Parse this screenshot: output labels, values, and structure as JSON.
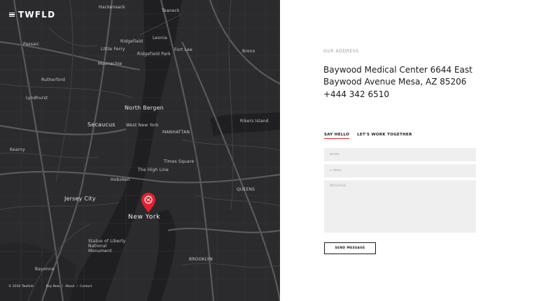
{
  "header": {
    "logo": "TWFLD",
    "menu_icon": "hamburger-menu-icon"
  },
  "map": {
    "labels": {
      "hackensack": "Hackensack",
      "teaneck": "Teaneck",
      "leonia": "Leonia",
      "fort_lee": "Fort Lee",
      "ridgefield": "Ridgefield",
      "ridgefield_park": "Ridgefield Park",
      "little_ferry": "Little Ferry",
      "passaic": "Passaic",
      "moonachie": "Moonachie",
      "bronx": "Bronx",
      "rutherford": "Rutherford",
      "lyndhurst": "Lyndhurst",
      "north_bergen": "North Bergen",
      "secaucus": "Secaucus",
      "west_new_york": "West New York",
      "manhattan": "MANHATTAN",
      "rikers_island": "Rikers Island",
      "kearny": "Kearny",
      "times_square": "Times Square",
      "the_high_line": "The High Line",
      "hoboken": "Hoboken",
      "jersey_city": "Jersey City",
      "new_york": "New York",
      "queens": "QUEENS",
      "brooklyn": "BROOKLYN",
      "statue_of_liberty": "Statue of Liberty National Monument",
      "bayonne": "Bayonne"
    },
    "pin_icon": "map-pin-icon"
  },
  "footer": {
    "copyright": "© 2016 Twofold",
    "links": [
      "Buy Now",
      "About",
      "Contact"
    ],
    "separator": "/"
  },
  "contact": {
    "address_label": "OUR ADDRESS",
    "address": "Baywood Medical Center 6644 East Baywood Avenue Mesa, AZ 85206",
    "phone": "+444 342 6510",
    "tabs": [
      {
        "label": "SAY HELLO",
        "active": true
      },
      {
        "label": "LET'S WORK TOGETHER",
        "active": false
      }
    ],
    "form": {
      "name_placeholder": "NAME",
      "email_placeholder": "E-MAIL",
      "message_placeholder": "MESSAGE",
      "submit_label": "SEND MESSAGE"
    },
    "accent_color": "#e4202f"
  }
}
